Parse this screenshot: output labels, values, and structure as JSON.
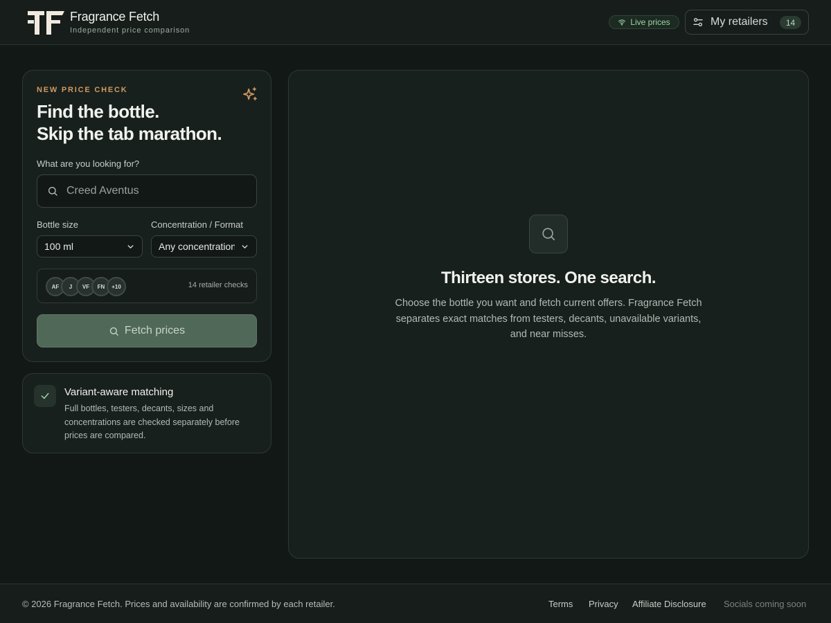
{
  "header": {
    "brand_name": "Fragrance Fetch",
    "brand_tagline": "Independent price comparison",
    "live_label": "Live prices",
    "retailers_label": "My retailers",
    "retailers_count": "14"
  },
  "search_card": {
    "eyebrow": "NEW PRICE CHECK",
    "headline_line1": "Find the bottle.",
    "headline_line2": "Skip the tab marathon.",
    "query_label": "What are you looking for?",
    "query_placeholder": "Creed Aventus",
    "query_value": "",
    "size_label": "Bottle size",
    "size_value": "100 ml",
    "concentration_label": "Concentration / Format",
    "concentration_value": "Any concentration",
    "retailer_chips": [
      "AF",
      "J",
      "VF",
      "FN",
      "+10"
    ],
    "retailer_checks": "14 retailer checks",
    "fetch_label": "Fetch prices"
  },
  "variant_card": {
    "title": "Variant-aware matching",
    "description": "Full bottles, testers, decants, sizes and concentrations are checked separately before prices are compared."
  },
  "results": {
    "empty_title": "Thirteen stores. One search.",
    "empty_description": "Choose the bottle you want and fetch current offers. Fragrance Fetch separates exact matches from testers, decants, unavailable variants, and near misses."
  },
  "footer": {
    "copyright": "© 2026 Fragrance Fetch. Prices and availability are confirmed by each retailer.",
    "terms": "Terms",
    "privacy": "Privacy",
    "affiliate": "Affiliate Disclosure",
    "socials": "Socials coming soon"
  },
  "colors": {
    "accent_orange": "#d19a62",
    "accent_green": "#9fd3a6",
    "button_green": "#4f6858",
    "background": "#121816"
  }
}
